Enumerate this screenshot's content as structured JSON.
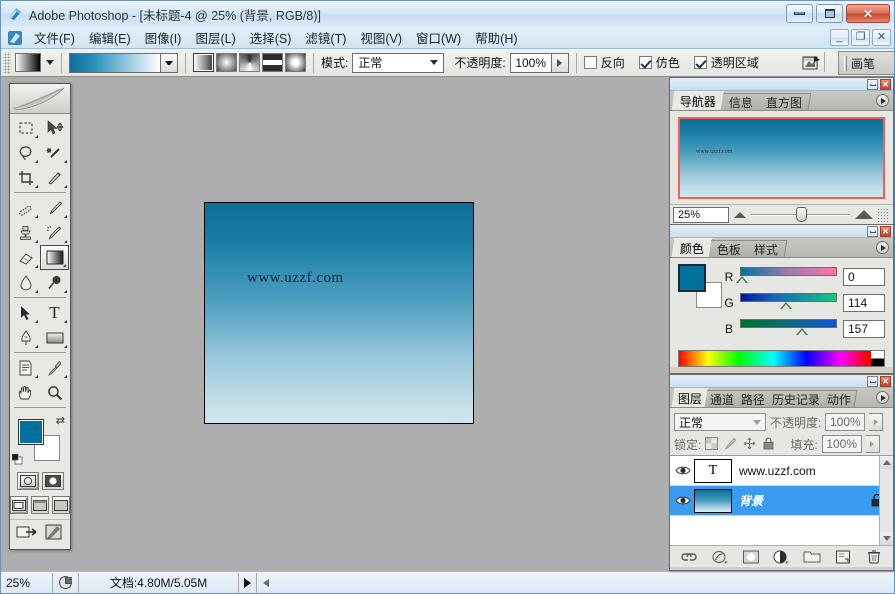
{
  "window": {
    "title": "Adobe Photoshop - [未标题-4 @ 25% (背景, RGB/8)]",
    "app_name": "Adobe Photoshop",
    "minimize_label": "",
    "maximize_label": "",
    "close_label": "✕"
  },
  "mdi": {
    "minimize_label": "_",
    "restore_label": "❐",
    "close_label": "✕"
  },
  "menubar": {
    "items": [
      {
        "label": "文件(F)"
      },
      {
        "label": "编辑(E)"
      },
      {
        "label": "图像(I)"
      },
      {
        "label": "图层(L)"
      },
      {
        "label": "选择(S)"
      },
      {
        "label": "滤镜(T)"
      },
      {
        "label": "视图(V)"
      },
      {
        "label": "窗口(W)"
      },
      {
        "label": "帮助(H)"
      }
    ]
  },
  "options_bar": {
    "gradient_picker_label": "",
    "gradient_types": [
      {
        "name": "linear-gradient-button",
        "selected": true
      },
      {
        "name": "radial-gradient-button",
        "selected": false
      },
      {
        "name": "angle-gradient-button",
        "selected": false
      },
      {
        "name": "reflected-gradient-button",
        "selected": false
      },
      {
        "name": "diamond-gradient-button",
        "selected": false
      }
    ],
    "mode_label": "模式:",
    "mode_value": "正常",
    "opacity_label": "不透明度:",
    "opacity_value": "100%",
    "checkboxes": [
      {
        "label": "反向",
        "checked": false
      },
      {
        "label": "仿色",
        "checked": true
      },
      {
        "label": "透明区域",
        "checked": true
      }
    ],
    "palette_well_label": "画笔"
  },
  "toolbox": {
    "tools": [
      {
        "name": "rectangular-marquee-tool",
        "has_submenu": true,
        "selected": false
      },
      {
        "name": "move-tool",
        "has_submenu": false,
        "selected": false
      },
      {
        "name": "lasso-tool",
        "has_submenu": true,
        "selected": false
      },
      {
        "name": "magic-wand-tool",
        "has_submenu": true,
        "selected": false
      },
      {
        "name": "crop-tool",
        "has_submenu": true,
        "selected": false
      },
      {
        "name": "slice-tool",
        "has_submenu": true,
        "selected": false
      },
      {
        "name": "healing-brush-tool",
        "has_submenu": true,
        "selected": false
      },
      {
        "name": "brush-tool",
        "has_submenu": true,
        "selected": false
      },
      {
        "name": "clone-stamp-tool",
        "has_submenu": true,
        "selected": false
      },
      {
        "name": "history-brush-tool",
        "has_submenu": true,
        "selected": false
      },
      {
        "name": "eraser-tool",
        "has_submenu": true,
        "selected": false
      },
      {
        "name": "gradient-tool",
        "has_submenu": true,
        "selected": true
      },
      {
        "name": "blur-tool",
        "has_submenu": true,
        "selected": false
      },
      {
        "name": "dodge-tool",
        "has_submenu": true,
        "selected": false
      },
      {
        "name": "path-selection-tool",
        "has_submenu": true,
        "selected": false
      },
      {
        "name": "type-tool",
        "has_submenu": true,
        "selected": false
      },
      {
        "name": "pen-tool",
        "has_submenu": true,
        "selected": false
      },
      {
        "name": "rectangle-shape-tool",
        "has_submenu": true,
        "selected": false
      },
      {
        "name": "notes-tool",
        "has_submenu": true,
        "selected": false
      },
      {
        "name": "eyedropper-tool",
        "has_submenu": true,
        "selected": false
      },
      {
        "name": "hand-tool",
        "has_submenu": false,
        "selected": false
      },
      {
        "name": "zoom-tool",
        "has_submenu": false,
        "selected": false
      }
    ],
    "foreground_color": "#00719d",
    "background_color": "#ffffff",
    "mask_modes": [
      {
        "name": "standard-mask-mode-button",
        "selected": true
      },
      {
        "name": "quick-mask-mode-button",
        "selected": false
      }
    ],
    "screen_modes": [
      {
        "name": "standard-screen-mode-button",
        "selected": true
      },
      {
        "name": "full-screen-with-menubar-button",
        "selected": false
      },
      {
        "name": "full-screen-mode-button",
        "selected": false
      }
    ],
    "jump_to_label": ""
  },
  "document": {
    "watermark_text": "www.uzzf.com",
    "gradient_top_color": "#0b6e97",
    "gradient_bottom_color": "#cfe5ee"
  },
  "navigator_panel": {
    "tabs": [
      {
        "label": "导航器",
        "active": true
      },
      {
        "label": "信息",
        "active": false
      },
      {
        "label": "直方图",
        "active": false
      }
    ],
    "thumbnail_watermark": "www.uzzf.com",
    "zoom_value": "25%",
    "view_box_color": "#f4604d"
  },
  "color_panel": {
    "tabs": [
      {
        "label": "颜色",
        "active": true
      },
      {
        "label": "色板",
        "active": false
      },
      {
        "label": "样式",
        "active": false
      }
    ],
    "foreground_color": "#00719d",
    "background_color": "#ffffff",
    "channels": [
      {
        "label": "R",
        "value": "0",
        "pct": 0
      },
      {
        "label": "G",
        "value": "114",
        "pct": 45
      },
      {
        "label": "B",
        "value": "157",
        "pct": 62
      }
    ]
  },
  "layers_panel": {
    "tabs": [
      {
        "label": "图层",
        "active": true
      },
      {
        "label": "通道",
        "active": false
      },
      {
        "label": "路径",
        "active": false
      },
      {
        "label": "历史记录",
        "active": false
      },
      {
        "label": "动作",
        "active": false
      }
    ],
    "blend_mode": "正常",
    "opacity_label": "不透明度:",
    "opacity_value": "100%",
    "lock_label": "锁定:",
    "fill_label": "填充:",
    "fill_value": "100%",
    "lock_buttons": [
      {
        "name": "lock-transparent-pixels-button"
      },
      {
        "name": "lock-image-pixels-button"
      },
      {
        "name": "lock-position-button"
      },
      {
        "name": "lock-all-button"
      }
    ],
    "layers": [
      {
        "name": "www.uzzf.com",
        "type": "text",
        "visible": true,
        "selected": false,
        "locked": false
      },
      {
        "name": "背景",
        "type": "image",
        "visible": true,
        "selected": true,
        "locked": true
      }
    ],
    "footer_buttons": [
      {
        "name": "link-layers-button"
      },
      {
        "name": "add-layer-style-button"
      },
      {
        "name": "add-layer-mask-button"
      },
      {
        "name": "new-fill-adjustment-layer-button"
      },
      {
        "name": "new-group-button"
      },
      {
        "name": "new-layer-button"
      },
      {
        "name": "delete-layer-button"
      }
    ]
  },
  "statusbar": {
    "zoom_value": "25%",
    "doc_info": "文档:4.80M/5.05M"
  }
}
